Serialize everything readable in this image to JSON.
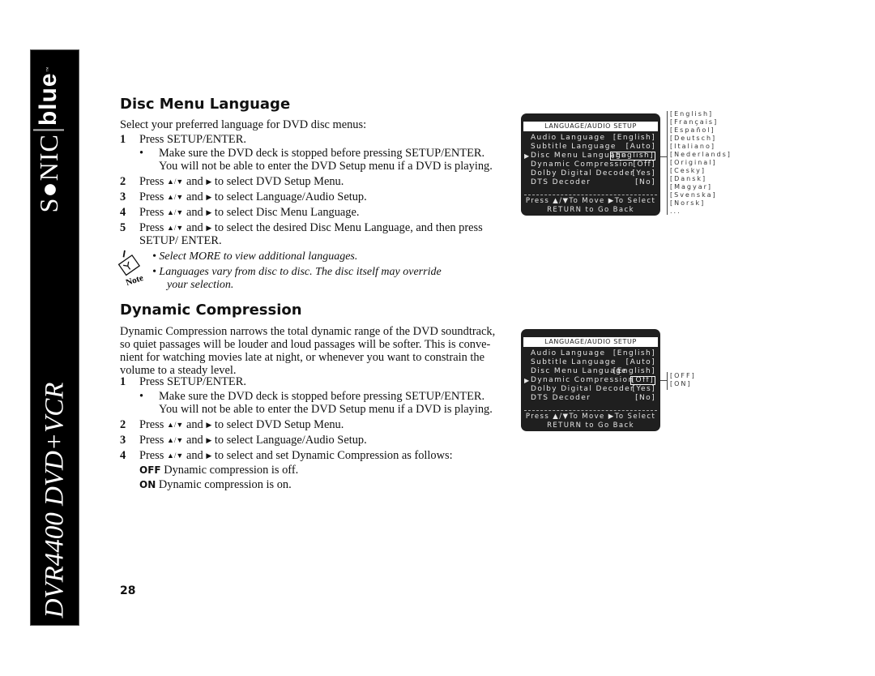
{
  "sidebar": {
    "brand_sonic": "S●NIC",
    "brand_blue": "blue",
    "brand_tm": "™",
    "model": "DVR4400 DVD+VCR"
  },
  "symbols": {
    "up_down": "▲/▼",
    "right": "▶"
  },
  "disc_menu": {
    "heading": "Disc Menu Language",
    "intro": "Select your preferred language for DVD disc menus:",
    "steps": [
      {
        "num": "1",
        "text": "Press SETUP/ENTER."
      },
      {
        "num": "2",
        "pre": "Press",
        "mid": "and",
        "post": "to select DVD Setup Menu."
      },
      {
        "num": "3",
        "pre": "Press",
        "mid": "and",
        "post": "to select Language/Audio Setup."
      },
      {
        "num": "4",
        "pre": "Press",
        "mid": "and",
        "post": "to select Disc Menu Language."
      },
      {
        "num": "5",
        "pre": "Press",
        "mid": "and",
        "post": "to select the desired Disc Menu Language, and then press",
        "cont": "SETUP/ ENTER."
      }
    ],
    "bullet_1": "•",
    "bullet_line1": "Make sure the DVD deck is stopped before pressing SETUP/ENTER.",
    "bullet_line2": "You will not be able to enter the DVD Setup menu if a DVD is playing.",
    "notes": [
      "• Select MORE to view additional languages.",
      "• Languages vary from disc to disc. The disc itself may override",
      "your selection."
    ],
    "note_label": "Note"
  },
  "dynamic": {
    "heading": "Dynamic Compression",
    "intro_lines": [
      "Dynamic Compression narrows the total dynamic range of the DVD soundtrack,",
      "so quiet passages will be louder and loud passages will be softer. This is conve-",
      "nient for watching movies late at night, or whenever you want to constrain the",
      "volume to a steady level."
    ],
    "steps": [
      {
        "num": "1",
        "text": "Press SETUP/ENTER."
      },
      {
        "num": "2",
        "pre": "Press",
        "mid": "and",
        "post": "to select DVD Setup Menu."
      },
      {
        "num": "3",
        "pre": "Press",
        "mid": "and",
        "post": "to select Language/Audio Setup."
      },
      {
        "num": "4",
        "pre": "Press",
        "mid": "and",
        "post": "to select and set Dynamic Compression as follows:"
      }
    ],
    "bullet_line1": "Make sure the DVD deck is stopped before pressing SETUP/ENTER.",
    "bullet_line2": "You will not be able to enter the DVD Setup menu if a DVD is playing.",
    "options": [
      {
        "key": "OFF",
        "desc": "Dynamic compression is off."
      },
      {
        "key": "ON",
        "desc": "Dynamic compression is on."
      }
    ]
  },
  "osd1": {
    "title": "LANGUAGE/AUDIO SETUP",
    "rows": [
      {
        "label": "Audio Language",
        "value": "[English]"
      },
      {
        "label": "Subtitle Language",
        "value": "[Auto]"
      },
      {
        "label": "Disc Menu Language",
        "value": "[English]",
        "selected": true
      },
      {
        "label": "Dynamic Compression",
        "value": "[Off]"
      },
      {
        "label": "Dolby Digital Decoder",
        "value": "[Yes]"
      },
      {
        "label": "DTS Decoder",
        "value": "[No]"
      }
    ],
    "footer1": "Press ▲/▼To Move ▶To Select",
    "footer2": "RETURN to Go Back",
    "pointer": "▶",
    "options": [
      "[English]",
      "[Français]",
      "[Español]",
      "[Deutsch]",
      "[Italiano]",
      "[Nederlands]",
      "[Original]",
      "[Cesky]",
      "[Dansk]",
      "[Magyar]",
      "[Svenska]",
      "[Norsk]",
      "..."
    ]
  },
  "osd2": {
    "title": "LANGUAGE/AUDIO SETUP",
    "rows": [
      {
        "label": "Audio Language",
        "value": "[English]"
      },
      {
        "label": "Subtitle Language",
        "value": "[Auto]"
      },
      {
        "label": "Disc Menu Language",
        "value": "[English]"
      },
      {
        "label": "Dynamic Compression",
        "value": "[Off]",
        "selected": true
      },
      {
        "label": "Dolby Digital Decoder",
        "value": "[Yes]"
      },
      {
        "label": "DTS Decoder",
        "value": "[No]"
      }
    ],
    "footer1": "Press ▲/▼To Move ▶To Select",
    "footer2": "RETURN to Go Back",
    "pointer": "▶",
    "options": [
      "[OFF]",
      "[ON]"
    ]
  },
  "page_number": "28"
}
